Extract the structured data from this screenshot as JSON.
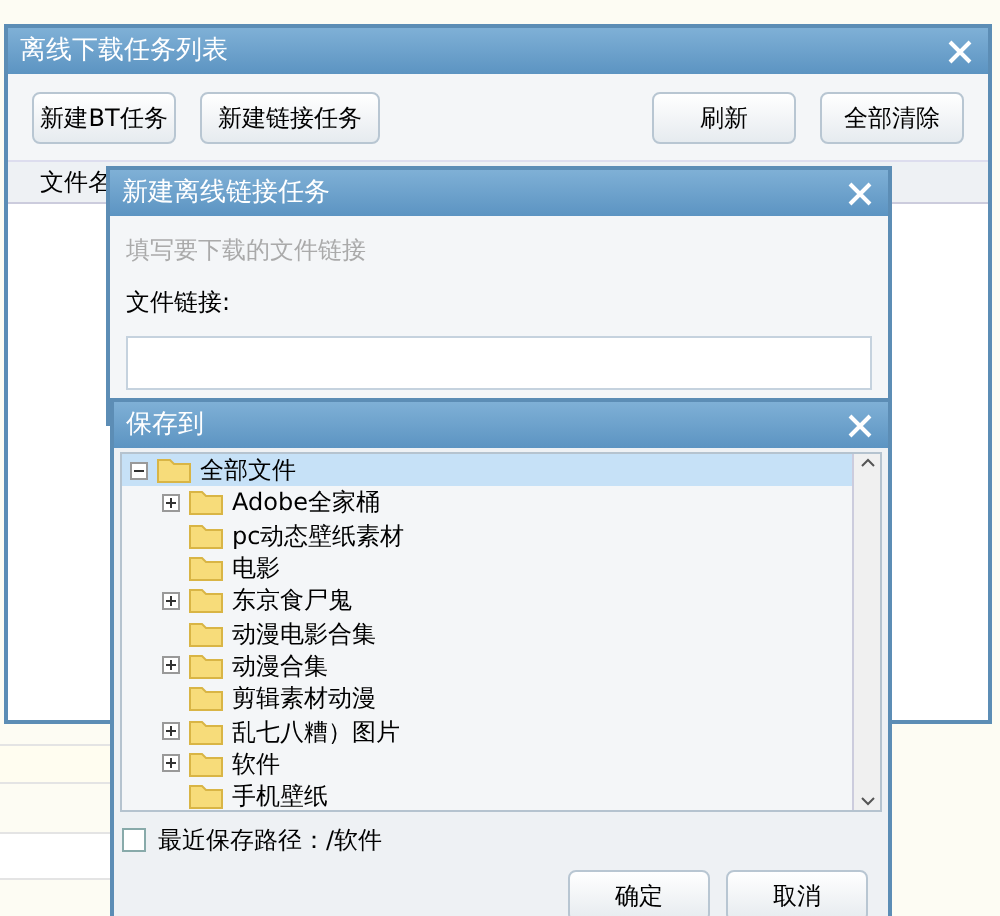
{
  "task_list_window": {
    "title": "离线下载任务列表",
    "toolbar_left": [
      "新建BT任务",
      "新建链接任务"
    ],
    "toolbar_right": [
      "刷新",
      "全部清除"
    ],
    "columns": [
      "文件名"
    ]
  },
  "link_dialog": {
    "title": "新建离线链接任务",
    "hint": "填写要下载的文件链接",
    "field_label": "文件链接:"
  },
  "save_dialog": {
    "title": "保存到",
    "tree": [
      {
        "label": "全部文件",
        "selected": true,
        "expanded": true,
        "children": [
          {
            "label": "Adobe全家桶",
            "selected": false,
            "expanded": false
          },
          {
            "label": "pc动态壁纸素材",
            "selected": false
          },
          {
            "label": "电影",
            "selected": false
          },
          {
            "label": "东京食尸鬼",
            "selected": false,
            "expanded": false
          },
          {
            "label": "动漫电影合集",
            "selected": false
          },
          {
            "label": "动漫合集",
            "selected": false,
            "expanded": false
          },
          {
            "label": "剪辑素材动漫",
            "selected": false
          },
          {
            "label": "乱七八糟）图片",
            "selected": false,
            "expanded": false
          },
          {
            "label": "软件",
            "selected": false,
            "expanded": false
          },
          {
            "label": "手机壁纸",
            "selected": false
          }
        ]
      }
    ],
    "recent_path": {
      "label": "最近保存路径：/软件",
      "checked": false
    },
    "buttons": [
      "确定",
      "取消"
    ]
  }
}
